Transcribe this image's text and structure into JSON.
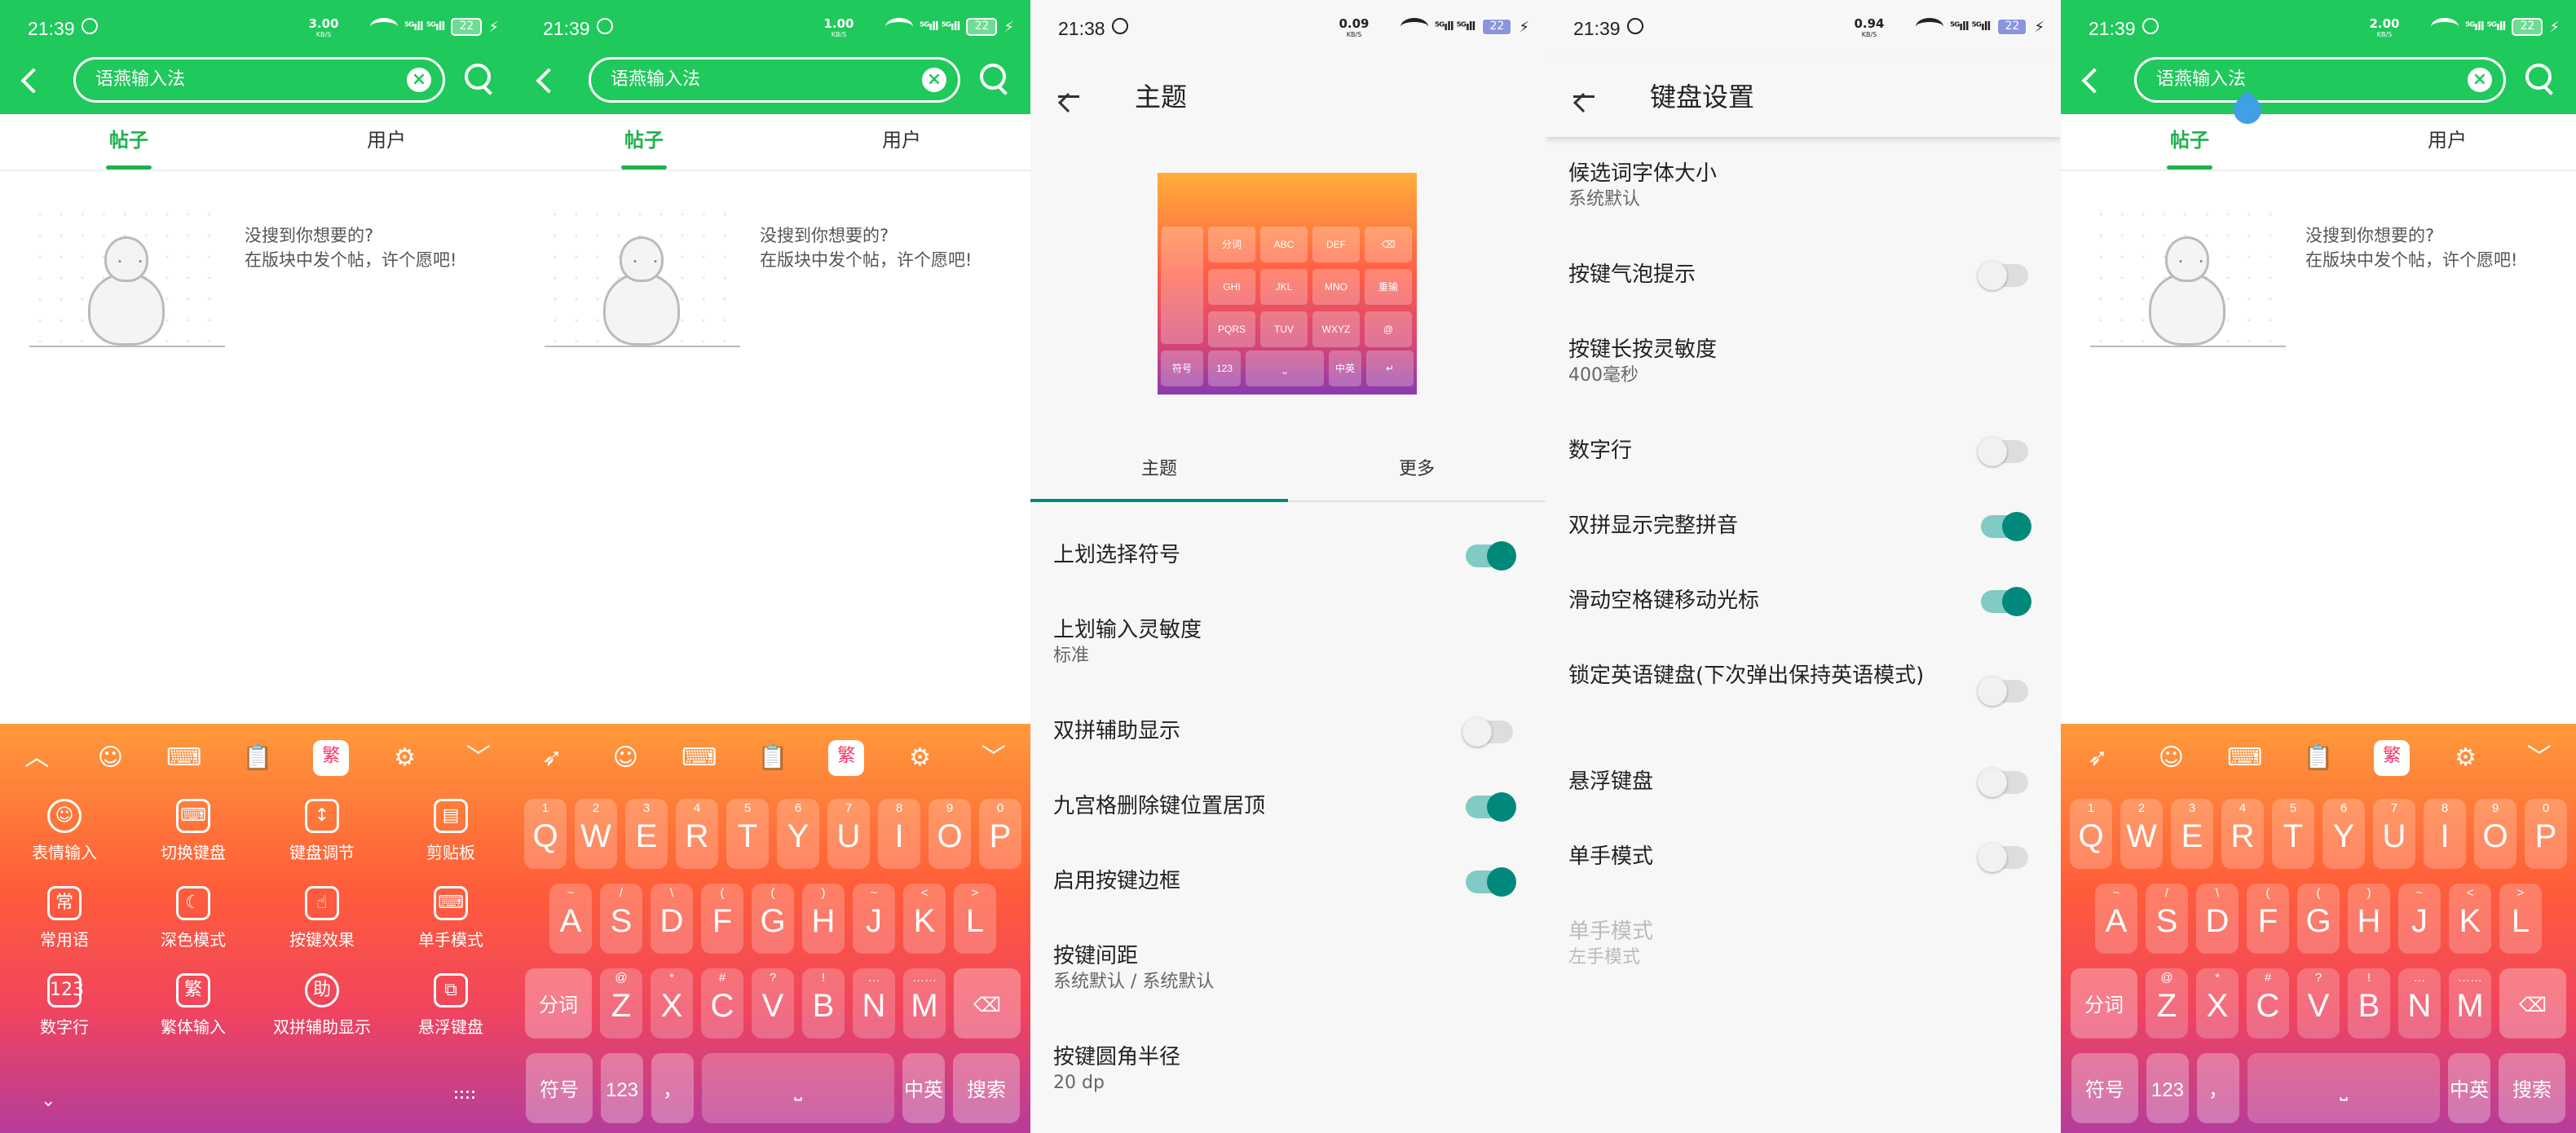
{
  "status": {
    "p1": {
      "time": "21:39",
      "speed": "3.00",
      "unit": "KB/S",
      "battery": "22"
    },
    "p2": {
      "time": "21:39",
      "speed": "1.00",
      "unit": "KB/S",
      "battery": "22"
    },
    "p3": {
      "time": "21:38",
      "speed": "0.09",
      "unit": "KB/S",
      "battery": "22"
    },
    "p4": {
      "time": "21:39",
      "speed": "0.94",
      "unit": "KB/S",
      "battery": "22"
    },
    "p5": {
      "time": "21:39",
      "speed": "2.00",
      "unit": "KB/S",
      "battery": "22"
    },
    "signal": "⁵ᴳıll ⁵ᴳıll"
  },
  "search": {
    "query": "语燕输入法",
    "clear": "×"
  },
  "tabs": {
    "posts": "帖子",
    "users": "用户"
  },
  "empty": {
    "line1": "没搜到你想要的?",
    "line2": "在版块中发个帖，许个愿吧!"
  },
  "toolbar": {
    "up": "︿",
    "emoji": "☺",
    "keyboard": "⌨",
    "clipboard": "📋",
    "trad": "繁",
    "settings": "⚙",
    "down": "﹀",
    "swipe": "➶"
  },
  "func_grid": [
    {
      "icon": "☺",
      "label": "表情输入"
    },
    {
      "icon": "⌨",
      "label": "切换键盘"
    },
    {
      "icon": "↕",
      "label": "键盘调节"
    },
    {
      "icon": "▤",
      "label": "剪贴板"
    },
    {
      "icon": "常",
      "label": "常用语"
    },
    {
      "icon": "☾",
      "label": "深色模式"
    },
    {
      "icon": "☝",
      "label": "按键效果"
    },
    {
      "icon": "⌨",
      "label": "单手模式"
    },
    {
      "icon": "123",
      "label": "数字行"
    },
    {
      "icon": "繁",
      "label": "繁体输入"
    },
    {
      "icon": "助",
      "label": "双拼辅助显示"
    },
    {
      "icon": "⧉",
      "label": "悬浮键盘"
    }
  ],
  "kb_more": "⌄",
  "keyboard": {
    "row1": [
      {
        "k": "Q",
        "h": "1"
      },
      {
        "k": "W",
        "h": "2"
      },
      {
        "k": "E",
        "h": "3"
      },
      {
        "k": "R",
        "h": "4"
      },
      {
        "k": "T",
        "h": "5"
      },
      {
        "k": "Y",
        "h": "6"
      },
      {
        "k": "U",
        "h": "7"
      },
      {
        "k": "I",
        "h": "8"
      },
      {
        "k": "O",
        "h": "9"
      },
      {
        "k": "P",
        "h": "0"
      }
    ],
    "row2": [
      {
        "k": "A",
        "h": "~"
      },
      {
        "k": "S",
        "h": "/"
      },
      {
        "k": "D",
        "h": "\\"
      },
      {
        "k": "F",
        "h": "("
      },
      {
        "k": "G",
        "h": "("
      },
      {
        "k": "H",
        "h": ")"
      },
      {
        "k": "J",
        "h": "~"
      },
      {
        "k": "K",
        "h": "<"
      },
      {
        "k": "L",
        "h": ">"
      }
    ],
    "row3": [
      {
        "k": "Z",
        "h": "@"
      },
      {
        "k": "X",
        "h": "*"
      },
      {
        "k": "C",
        "h": "#"
      },
      {
        "k": "V",
        "h": "?"
      },
      {
        "k": "B",
        "h": "!"
      },
      {
        "k": "N",
        "h": "…"
      },
      {
        "k": "M",
        "h": "……"
      }
    ],
    "segment": "分词",
    "backspace": "⌫",
    "symbol": "符号",
    "num": "123",
    "comma": "，",
    "space": "⎵",
    "lang": "中英",
    "search": "搜索"
  },
  "theme": {
    "title": "主题",
    "preview_keys": [
      "分词",
      "ABC",
      "DEF",
      "⌫",
      "GHI",
      "JKL",
      "MNO",
      "重输",
      "PQRS",
      "TUV",
      "WXYZ",
      "@",
      "符号",
      "123",
      "⎵",
      "中英",
      "↵"
    ],
    "tabs": [
      "主题",
      "更多"
    ],
    "rows": [
      {
        "t": "上划选择符号",
        "on": true
      },
      {
        "t": "上划输入灵敏度",
        "sub": "标准"
      },
      {
        "t": "双拼辅助显示",
        "on": false
      },
      {
        "t": "九宫格删除键位置居顶",
        "on": true
      },
      {
        "t": "启用按键边框",
        "on": true
      },
      {
        "t": "按键间距",
        "sub": "系统默认 / 系统默认"
      },
      {
        "t": "按键圆角半径",
        "sub": "20 dp"
      }
    ]
  },
  "kbset": {
    "title": "键盘设置",
    "rows": [
      {
        "t": "候选词字体大小",
        "sub": "系统默认"
      },
      {
        "t": "按键气泡提示",
        "on": false
      },
      {
        "t": "按键长按灵敏度",
        "sub": "400毫秒"
      },
      {
        "t": "数字行",
        "on": false
      },
      {
        "t": "双拼显示完整拼音",
        "on": true
      },
      {
        "t": "滑动空格键移动光标",
        "on": true
      },
      {
        "t": "锁定英语键盘(下次弹出保持英语模式)",
        "on": false
      },
      {
        "t": "悬浮键盘",
        "on": false
      },
      {
        "t": "单手模式",
        "on": false
      },
      {
        "t": "单手模式",
        "sub": "左手模式",
        "disabled": true
      }
    ]
  }
}
